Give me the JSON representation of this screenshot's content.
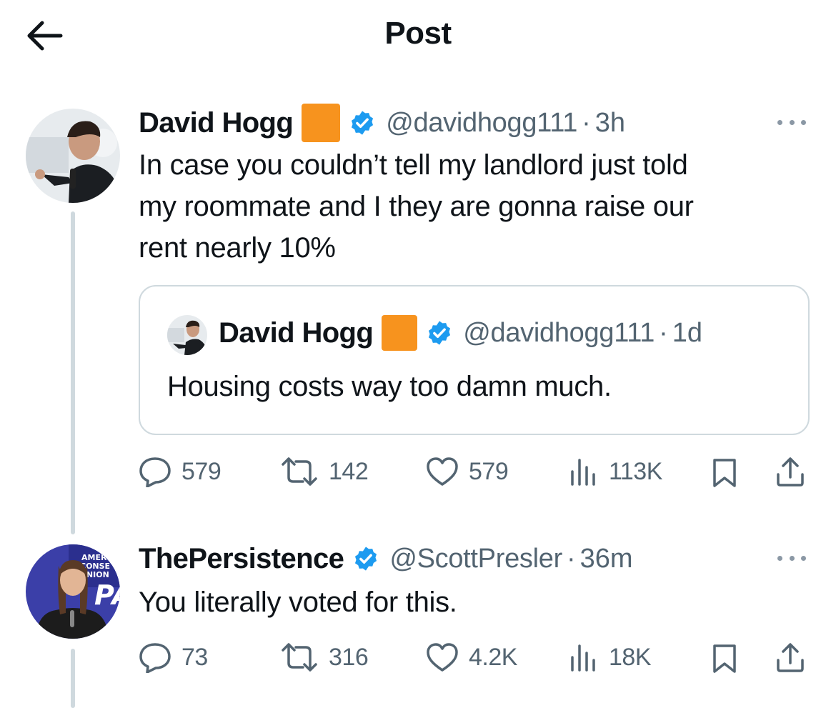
{
  "header": {
    "title": "Post",
    "back_icon": "arrow-left-icon"
  },
  "main_post": {
    "author": {
      "display_name": "David Hogg",
      "emoji_color": "#f7931e",
      "handle": "@davidhogg111",
      "time": "3h"
    },
    "text_lines": [
      "In case you couldn’t tell my landlord just told",
      "my roommate and I they are gonna raise our",
      "rent nearly 10%"
    ],
    "quoted": {
      "author": {
        "display_name": "David Hogg",
        "handle": "@davidhogg111",
        "time": "1d"
      },
      "text": "Housing costs way too damn much."
    },
    "actions": {
      "replies": "579",
      "reposts": "142",
      "likes": "579",
      "views": "113K"
    }
  },
  "reply": {
    "author": {
      "display_name": "ThePersistence",
      "handle": "@ScottPresler",
      "time": "36m"
    },
    "text": "You literally voted for this.",
    "actions": {
      "replies": "73",
      "reposts": "316",
      "likes": "4.2K",
      "views": "18K"
    }
  },
  "separator": "·",
  "colors": {
    "verified": "#1d9bf0",
    "secondary_text": "#536471",
    "thread_line": "#cfd9de"
  }
}
